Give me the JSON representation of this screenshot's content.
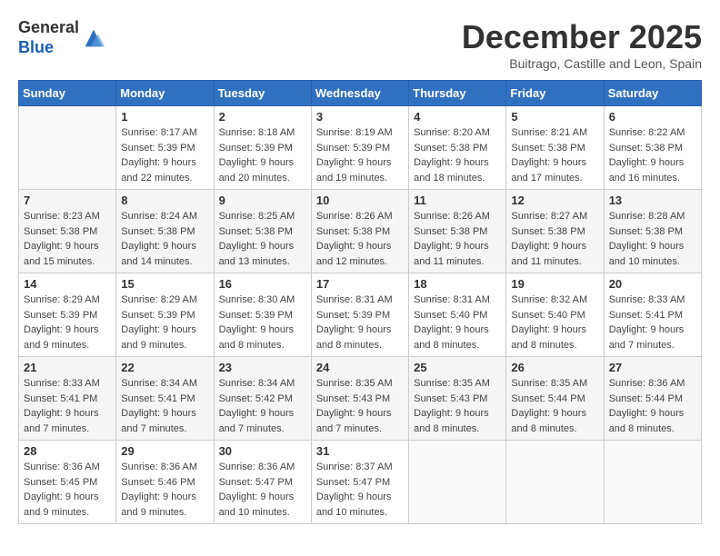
{
  "header": {
    "logo_general": "General",
    "logo_blue": "Blue",
    "month_title": "December 2025",
    "location": "Buitrago, Castille and Leon, Spain"
  },
  "days_of_week": [
    "Sunday",
    "Monday",
    "Tuesday",
    "Wednesday",
    "Thursday",
    "Friday",
    "Saturday"
  ],
  "weeks": [
    [
      {
        "day": "",
        "sunrise": "",
        "sunset": "",
        "daylight": ""
      },
      {
        "day": "1",
        "sunrise": "Sunrise: 8:17 AM",
        "sunset": "Sunset: 5:39 PM",
        "daylight": "Daylight: 9 hours and 22 minutes."
      },
      {
        "day": "2",
        "sunrise": "Sunrise: 8:18 AM",
        "sunset": "Sunset: 5:39 PM",
        "daylight": "Daylight: 9 hours and 20 minutes."
      },
      {
        "day": "3",
        "sunrise": "Sunrise: 8:19 AM",
        "sunset": "Sunset: 5:39 PM",
        "daylight": "Daylight: 9 hours and 19 minutes."
      },
      {
        "day": "4",
        "sunrise": "Sunrise: 8:20 AM",
        "sunset": "Sunset: 5:38 PM",
        "daylight": "Daylight: 9 hours and 18 minutes."
      },
      {
        "day": "5",
        "sunrise": "Sunrise: 8:21 AM",
        "sunset": "Sunset: 5:38 PM",
        "daylight": "Daylight: 9 hours and 17 minutes."
      },
      {
        "day": "6",
        "sunrise": "Sunrise: 8:22 AM",
        "sunset": "Sunset: 5:38 PM",
        "daylight": "Daylight: 9 hours and 16 minutes."
      }
    ],
    [
      {
        "day": "7",
        "sunrise": "Sunrise: 8:23 AM",
        "sunset": "Sunset: 5:38 PM",
        "daylight": "Daylight: 9 hours and 15 minutes."
      },
      {
        "day": "8",
        "sunrise": "Sunrise: 8:24 AM",
        "sunset": "Sunset: 5:38 PM",
        "daylight": "Daylight: 9 hours and 14 minutes."
      },
      {
        "day": "9",
        "sunrise": "Sunrise: 8:25 AM",
        "sunset": "Sunset: 5:38 PM",
        "daylight": "Daylight: 9 hours and 13 minutes."
      },
      {
        "day": "10",
        "sunrise": "Sunrise: 8:26 AM",
        "sunset": "Sunset: 5:38 PM",
        "daylight": "Daylight: 9 hours and 12 minutes."
      },
      {
        "day": "11",
        "sunrise": "Sunrise: 8:26 AM",
        "sunset": "Sunset: 5:38 PM",
        "daylight": "Daylight: 9 hours and 11 minutes."
      },
      {
        "day": "12",
        "sunrise": "Sunrise: 8:27 AM",
        "sunset": "Sunset: 5:38 PM",
        "daylight": "Daylight: 9 hours and 11 minutes."
      },
      {
        "day": "13",
        "sunrise": "Sunrise: 8:28 AM",
        "sunset": "Sunset: 5:38 PM",
        "daylight": "Daylight: 9 hours and 10 minutes."
      }
    ],
    [
      {
        "day": "14",
        "sunrise": "Sunrise: 8:29 AM",
        "sunset": "Sunset: 5:39 PM",
        "daylight": "Daylight: 9 hours and 9 minutes."
      },
      {
        "day": "15",
        "sunrise": "Sunrise: 8:29 AM",
        "sunset": "Sunset: 5:39 PM",
        "daylight": "Daylight: 9 hours and 9 minutes."
      },
      {
        "day": "16",
        "sunrise": "Sunrise: 8:30 AM",
        "sunset": "Sunset: 5:39 PM",
        "daylight": "Daylight: 9 hours and 8 minutes."
      },
      {
        "day": "17",
        "sunrise": "Sunrise: 8:31 AM",
        "sunset": "Sunset: 5:39 PM",
        "daylight": "Daylight: 9 hours and 8 minutes."
      },
      {
        "day": "18",
        "sunrise": "Sunrise: 8:31 AM",
        "sunset": "Sunset: 5:40 PM",
        "daylight": "Daylight: 9 hours and 8 minutes."
      },
      {
        "day": "19",
        "sunrise": "Sunrise: 8:32 AM",
        "sunset": "Sunset: 5:40 PM",
        "daylight": "Daylight: 9 hours and 8 minutes."
      },
      {
        "day": "20",
        "sunrise": "Sunrise: 8:33 AM",
        "sunset": "Sunset: 5:41 PM",
        "daylight": "Daylight: 9 hours and 7 minutes."
      }
    ],
    [
      {
        "day": "21",
        "sunrise": "Sunrise: 8:33 AM",
        "sunset": "Sunset: 5:41 PM",
        "daylight": "Daylight: 9 hours and 7 minutes."
      },
      {
        "day": "22",
        "sunrise": "Sunrise: 8:34 AM",
        "sunset": "Sunset: 5:41 PM",
        "daylight": "Daylight: 9 hours and 7 minutes."
      },
      {
        "day": "23",
        "sunrise": "Sunrise: 8:34 AM",
        "sunset": "Sunset: 5:42 PM",
        "daylight": "Daylight: 9 hours and 7 minutes."
      },
      {
        "day": "24",
        "sunrise": "Sunrise: 8:35 AM",
        "sunset": "Sunset: 5:43 PM",
        "daylight": "Daylight: 9 hours and 7 minutes."
      },
      {
        "day": "25",
        "sunrise": "Sunrise: 8:35 AM",
        "sunset": "Sunset: 5:43 PM",
        "daylight": "Daylight: 9 hours and 8 minutes."
      },
      {
        "day": "26",
        "sunrise": "Sunrise: 8:35 AM",
        "sunset": "Sunset: 5:44 PM",
        "daylight": "Daylight: 9 hours and 8 minutes."
      },
      {
        "day": "27",
        "sunrise": "Sunrise: 8:36 AM",
        "sunset": "Sunset: 5:44 PM",
        "daylight": "Daylight: 9 hours and 8 minutes."
      }
    ],
    [
      {
        "day": "28",
        "sunrise": "Sunrise: 8:36 AM",
        "sunset": "Sunset: 5:45 PM",
        "daylight": "Daylight: 9 hours and 9 minutes."
      },
      {
        "day": "29",
        "sunrise": "Sunrise: 8:36 AM",
        "sunset": "Sunset: 5:46 PM",
        "daylight": "Daylight: 9 hours and 9 minutes."
      },
      {
        "day": "30",
        "sunrise": "Sunrise: 8:36 AM",
        "sunset": "Sunset: 5:47 PM",
        "daylight": "Daylight: 9 hours and 10 minutes."
      },
      {
        "day": "31",
        "sunrise": "Sunrise: 8:37 AM",
        "sunset": "Sunset: 5:47 PM",
        "daylight": "Daylight: 9 hours and 10 minutes."
      },
      {
        "day": "",
        "sunrise": "",
        "sunset": "",
        "daylight": ""
      },
      {
        "day": "",
        "sunrise": "",
        "sunset": "",
        "daylight": ""
      },
      {
        "day": "",
        "sunrise": "",
        "sunset": "",
        "daylight": ""
      }
    ]
  ]
}
